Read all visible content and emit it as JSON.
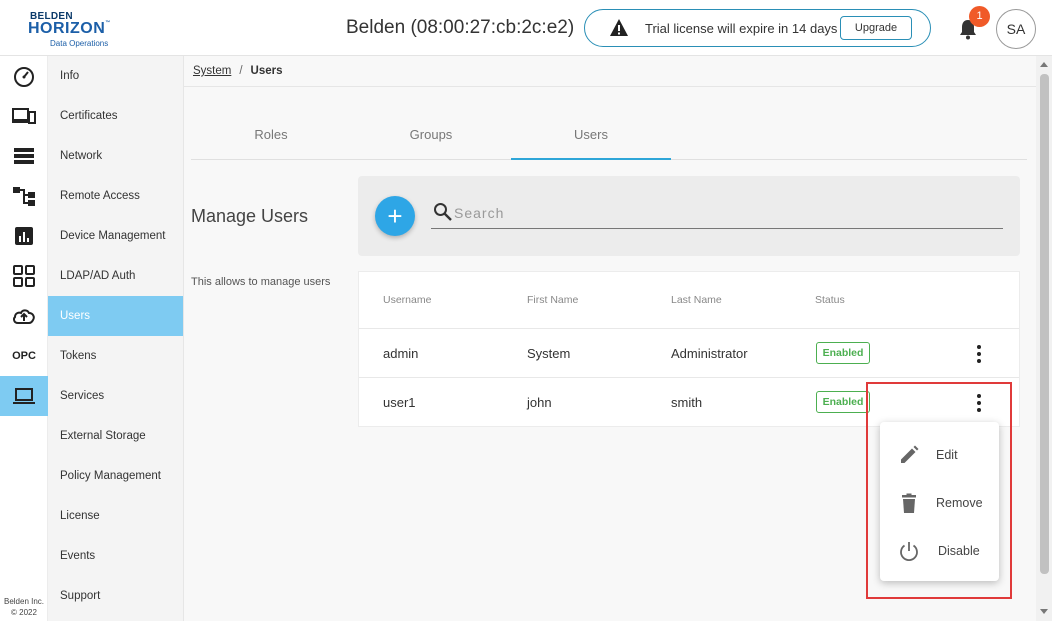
{
  "header": {
    "logo": {
      "line1": "BELDEN",
      "line2": "HORIZON",
      "tm": "™",
      "line3": "Data Operations"
    },
    "device_title": "Belden (08:00:27:cb:2c:e2)",
    "license_message": "Trial license will expire in 14 days",
    "upgrade_label": "Upgrade",
    "notification_count": "1",
    "avatar_initials": "SA"
  },
  "rail": {
    "items": [
      {
        "icon": "dashboard-icon"
      },
      {
        "icon": "devices-icon"
      },
      {
        "icon": "storage-icon"
      },
      {
        "icon": "topology-icon"
      },
      {
        "icon": "analytics-icon"
      },
      {
        "icon": "apps-grid-icon"
      },
      {
        "icon": "cloud-upload-icon"
      },
      {
        "icon": "opc-icon",
        "label": "OPC"
      },
      {
        "icon": "laptop-icon",
        "active": true
      }
    ],
    "footer_line1": "Belden Inc.",
    "footer_line2": "© 2022"
  },
  "subnav": {
    "items": [
      {
        "label": "Info"
      },
      {
        "label": "Certificates"
      },
      {
        "label": "Network"
      },
      {
        "label": "Remote Access"
      },
      {
        "label": "Device Management"
      },
      {
        "label": "LDAP/AD Auth"
      },
      {
        "label": "Users",
        "active": true
      },
      {
        "label": "Tokens"
      },
      {
        "label": "Services"
      },
      {
        "label": "External Storage"
      },
      {
        "label": "Policy Management"
      },
      {
        "label": "License"
      },
      {
        "label": "Events"
      },
      {
        "label": "Support"
      }
    ]
  },
  "breadcrumb": {
    "parent": "System",
    "separator": "/",
    "current": "Users"
  },
  "tabs": [
    {
      "label": "Roles"
    },
    {
      "label": "Groups"
    },
    {
      "label": "Users",
      "active": true
    }
  ],
  "section": {
    "title": "Manage Users",
    "description": "This allows to manage users"
  },
  "search": {
    "placeholder": "Search",
    "add_label": "+"
  },
  "table": {
    "columns": [
      "Username",
      "First Name",
      "Last Name",
      "Status"
    ],
    "rows": [
      {
        "username": "admin",
        "first_name": "System",
        "last_name": "Administrator",
        "status": "Enabled"
      },
      {
        "username": "user1",
        "first_name": "john",
        "last_name": "smith",
        "status": "Enabled"
      }
    ]
  },
  "row_menu": {
    "items": [
      {
        "label": "Edit",
        "icon": "pencil-icon"
      },
      {
        "label": "Remove",
        "icon": "trash-icon"
      },
      {
        "label": "Disable",
        "icon": "power-icon"
      }
    ]
  },
  "colors": {
    "accent": "#2ea6e6",
    "active_nav": "#7ecbf2",
    "enabled_status": "#4caf50",
    "notification_badge": "#f05a28",
    "highlight": "#e03a3a"
  }
}
